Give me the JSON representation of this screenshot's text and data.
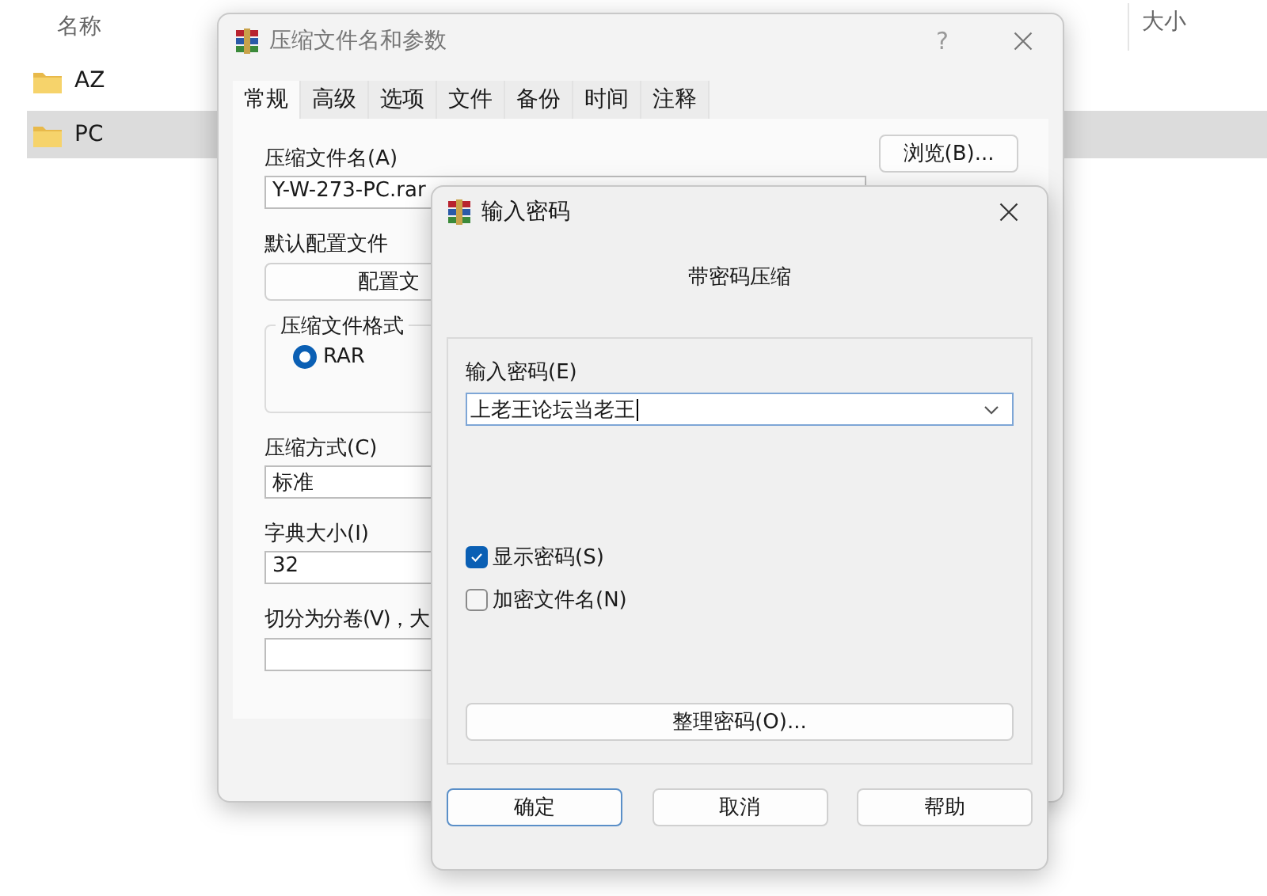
{
  "explorer": {
    "columns": [
      {
        "label": "名称"
      },
      {
        "label": "大小"
      }
    ],
    "rows": [
      {
        "name": "AZ",
        "selected": false
      },
      {
        "name": "PC",
        "selected": true
      }
    ]
  },
  "archive_dialog": {
    "title": "压缩文件名和参数",
    "help": "?",
    "tabs": [
      {
        "label": "常规",
        "selected": true
      },
      {
        "label": "高级",
        "selected": false
      },
      {
        "label": "选项",
        "selected": false
      },
      {
        "label": "文件",
        "selected": false
      },
      {
        "label": "备份",
        "selected": false
      },
      {
        "label": "时间",
        "selected": false
      },
      {
        "label": "注释",
        "selected": false
      }
    ],
    "archive_name_label": "压缩文件名(A)",
    "archive_name": "Y-W-273-PC.rar",
    "browse_button": "浏览(B)...",
    "profile_label": "默认配置文件",
    "profile_button": "配置文",
    "format_group": "压缩文件格式",
    "formats": [
      {
        "label": "RAR",
        "selected": true
      }
    ],
    "method_label": "压缩方式(C)",
    "method": "标准",
    "dict_label": "字典大小(I)",
    "dict": "32",
    "split_label": "切分为分卷(V)，大"
  },
  "password_dialog": {
    "title": "输入密码",
    "subtitle": "带密码压缩",
    "password_label": "输入密码(E)",
    "password": "上老王论坛当老王",
    "options": [
      {
        "label": "显示密码(S)",
        "checked": true
      },
      {
        "label": "加密文件名(N)",
        "checked": false
      }
    ],
    "organize_button": "整理密码(O)...",
    "buttons": [
      {
        "label": "确定",
        "focused": true
      },
      {
        "label": "取消",
        "focused": false
      },
      {
        "label": "帮助",
        "focused": false
      }
    ]
  }
}
